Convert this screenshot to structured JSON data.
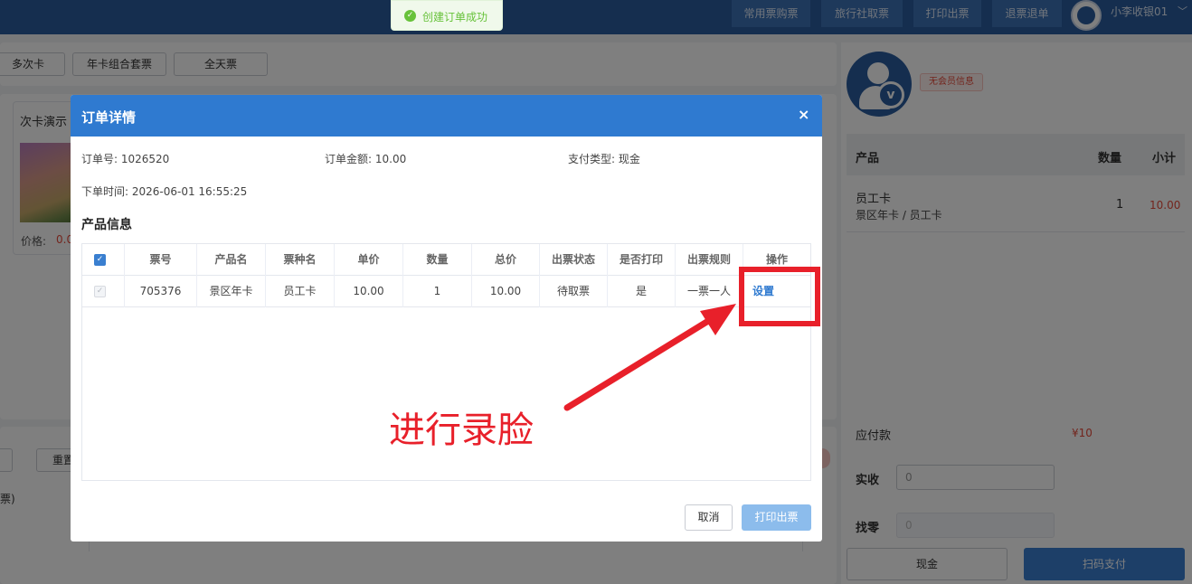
{
  "toast": {
    "icon": "check-circle-icon",
    "text": "创建订单成功"
  },
  "topbar": {
    "buttons": [
      "常用票购票",
      "旅行社取票",
      "打印出票",
      "退票退单"
    ],
    "username": "小李收银01"
  },
  "filters": [
    "多次卡",
    "年卡组合套票",
    "全天票"
  ],
  "card": {
    "title": "次卡演示",
    "price_label": "价格:",
    "price_value": "0.0"
  },
  "background": {
    "reset_label": "重置",
    "piao_fragment": "票)"
  },
  "sidebar": {
    "member_badge": "无会员信息",
    "columns": {
      "product": "产品",
      "qty": "数量",
      "subtotal": "小计"
    },
    "item": {
      "name": "员工卡",
      "sub": "景区年卡 / 员工卡",
      "qty": "1",
      "total": "10.00"
    },
    "due_label": "应付款",
    "due_value": "¥10",
    "paid_label": "实收",
    "paid_value": "0",
    "change_label": "找零",
    "change_value": "0",
    "cash_label": "现金",
    "scan_label": "扫码支付"
  },
  "modal": {
    "title": "订单详情",
    "close": "×",
    "order_no": "订单号: 1026520",
    "amount": "订单金额: 10.00",
    "pay_type": "支付类型: 现金",
    "order_time": "下单时间: 2026-06-01 16:55:25",
    "section_title": "产品信息",
    "columns": [
      "票号",
      "产品名",
      "票种名",
      "单价",
      "数量",
      "总价",
      "出票状态",
      "是否打印",
      "出票规则",
      "操作"
    ],
    "row": {
      "ticket_no": "705376",
      "product": "景区年卡",
      "ticket_type": "员工卡",
      "price": "10.00",
      "qty": "1",
      "total": "10.00",
      "status": "待取票",
      "printed": "是",
      "rule": "一票一人",
      "action": "设置"
    },
    "cancel_label": "取消",
    "print_label": "打印出票"
  },
  "annotation": {
    "text": "进行录脸",
    "color": "#e8202a"
  }
}
